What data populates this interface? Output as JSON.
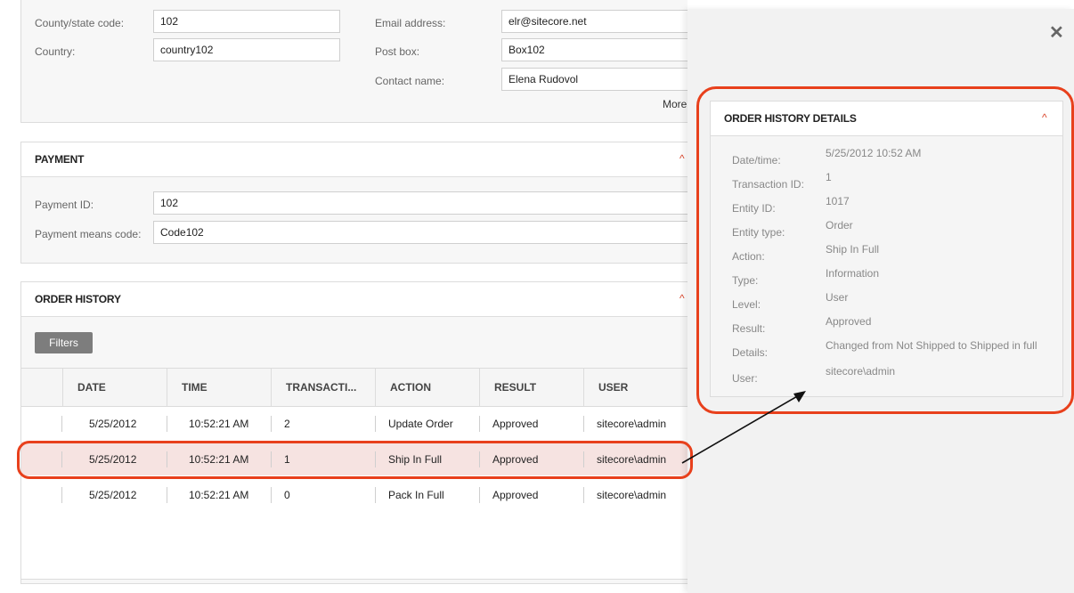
{
  "address": {
    "county_label": "County/state code:",
    "county_value": "102",
    "country_label": "Country:",
    "country_value": "country102",
    "email_label": "Email address:",
    "email_value": "elr@sitecore.net",
    "postbox_label": "Post box:",
    "postbox_value": "Box102",
    "contact_label": "Contact name:",
    "contact_value": "Elena Rudovol",
    "more_label": "More"
  },
  "payment": {
    "title": "PAYMENT",
    "id_label": "Payment ID:",
    "id_value": "102",
    "means_label": "Payment means code:",
    "means_value": "Code102"
  },
  "order_history": {
    "title": "ORDER HISTORY",
    "filters_label": "Filters",
    "columns": [
      "DATE",
      "TIME",
      "TRANSACTI...",
      "ACTION",
      "RESULT",
      "USER"
    ],
    "rows": [
      {
        "date": "5/25/2012",
        "time": "10:52:21 AM",
        "transaction": "2",
        "action": "Update Order",
        "result": "Approved",
        "user": "sitecore\\admin"
      },
      {
        "date": "5/25/2012",
        "time": "10:52:21 AM",
        "transaction": "1",
        "action": "Ship In Full",
        "result": "Approved",
        "user": "sitecore\\admin"
      },
      {
        "date": "5/25/2012",
        "time": "10:52:21 AM",
        "transaction": "0",
        "action": "Pack In Full",
        "result": "Approved",
        "user": "sitecore\\admin"
      }
    ],
    "selected_row": 1
  },
  "details": {
    "close_icon": "✕",
    "title": "ORDER HISTORY DETAILS",
    "chevron": "^",
    "fields": [
      {
        "label": "Date/time:",
        "value": "5/25/2012 10:52 AM"
      },
      {
        "label": "Transaction ID:",
        "value": "1"
      },
      {
        "label": "Entity ID:",
        "value": "1017"
      },
      {
        "label": "Entity type:",
        "value": "Order"
      },
      {
        "label": "Action:",
        "value": "Ship In Full"
      },
      {
        "label": "Type:",
        "value": "Information"
      },
      {
        "label": "Level:",
        "value": "User"
      },
      {
        "label": "Result:",
        "value": "Approved"
      },
      {
        "label": "Details:",
        "value": "Changed from Not Shipped to Shipped in full"
      },
      {
        "label": "User:",
        "value": "sitecore\\admin"
      }
    ]
  },
  "colors": {
    "highlight_red": "#e8401c",
    "selected_row_bg": "#f6e3e1",
    "chevron_red": "#d9442a",
    "filters_bg": "#7d7d7d"
  }
}
